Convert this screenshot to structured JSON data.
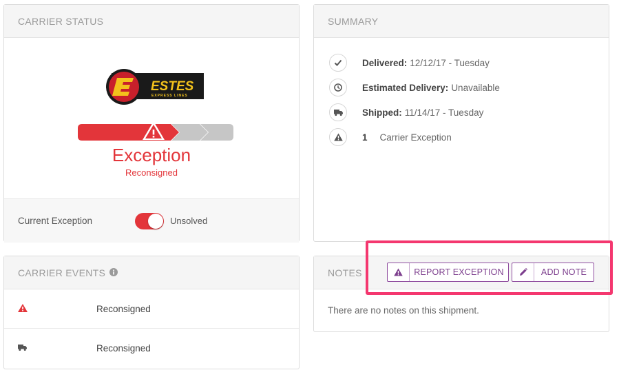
{
  "carrier_status": {
    "title": "CARRIER STATUS",
    "logo_text": "ESTES",
    "logo_subtext": "EXPRESS LINES",
    "status": "Exception",
    "status_detail": "Reconsigned",
    "progress_steps": 3,
    "current_exception_label": "Current Exception",
    "toggle_on": true,
    "toggle_label": "Unsolved"
  },
  "summary": {
    "title": "SUMMARY",
    "items": [
      {
        "icon": "check-icon",
        "label": "Delivered:",
        "value": "12/12/17 - Tuesday"
      },
      {
        "icon": "clock-icon",
        "label": "Estimated Delivery:",
        "value": "Unavailable"
      },
      {
        "icon": "truck-icon",
        "label": "Shipped:",
        "value": "11/14/17 - Tuesday"
      },
      {
        "icon": "warning-icon",
        "label": "1",
        "value": "Carrier Exception"
      }
    ]
  },
  "carrier_events": {
    "title": "CARRIER EVENTS",
    "events": [
      {
        "icon": "warning-icon",
        "text": "Reconsigned"
      },
      {
        "icon": "truck-icon",
        "text": "Reconsigned"
      }
    ]
  },
  "notes": {
    "title": "NOTES",
    "empty_text": "There are no notes on this shipment.",
    "report_exception_label": "REPORT EXCEPTION",
    "add_note_label": "ADD NOTE"
  },
  "colors": {
    "exception_red": "#e3353a",
    "button_purple": "#7d3f8e",
    "highlight_pink": "#f4376f"
  }
}
